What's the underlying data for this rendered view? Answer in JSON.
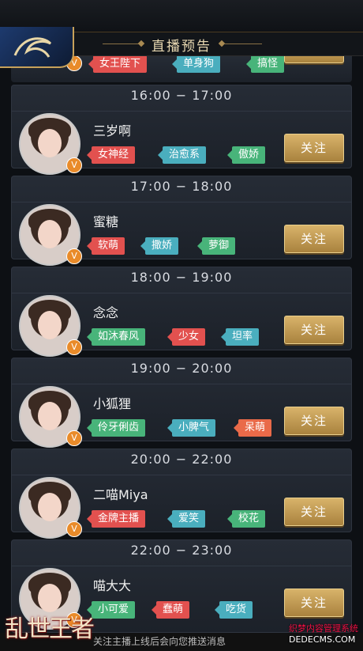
{
  "header": {
    "title": "直播预告"
  },
  "partial_card": {
    "tags": [
      "女王陛下",
      "单身狗",
      "搞怪"
    ]
  },
  "cards": [
    {
      "time": "16:00 − 17:00",
      "name": "三岁啊",
      "tags": [
        "女神经",
        "治愈系",
        "傲娇"
      ],
      "follow_label": "关注"
    },
    {
      "time": "17:00 − 18:00",
      "name": "蜜糖",
      "tags": [
        "软萌",
        "撒娇",
        "萝御"
      ],
      "follow_label": "关注"
    },
    {
      "time": "18:00 − 19:00",
      "name": "念念",
      "tags": [
        "如沐春风",
        "少女",
        "坦率"
      ],
      "follow_label": "关注"
    },
    {
      "time": "19:00 − 20:00",
      "name": "小狐狸",
      "tags": [
        "伶牙俐齿",
        "小脾气",
        "呆萌"
      ],
      "follow_label": "关注"
    },
    {
      "time": "20:00 − 22:00",
      "name": "二喵Miya",
      "tags": [
        "金牌主播",
        "爱笑",
        "校花"
      ],
      "follow_label": "关注"
    },
    {
      "time": "22:00 − 23:00",
      "name": "喵大大",
      "tags": [
        "小可爱",
        "蠢萌",
        "吃货"
      ],
      "follow_label": "关注"
    }
  ],
  "vip_badge": "V",
  "bottom_logo": "乱世王者",
  "footer_note": "关注主播上线后会向您推送消息",
  "watermark": {
    "line": "织梦内容管理系统",
    "url": "DEDECMS.COM"
  },
  "colors": {
    "accent_gold": "#c7a15a",
    "tag_red": "#e2514f",
    "tag_teal": "#4aaebe",
    "tag_green": "#48b47a"
  }
}
